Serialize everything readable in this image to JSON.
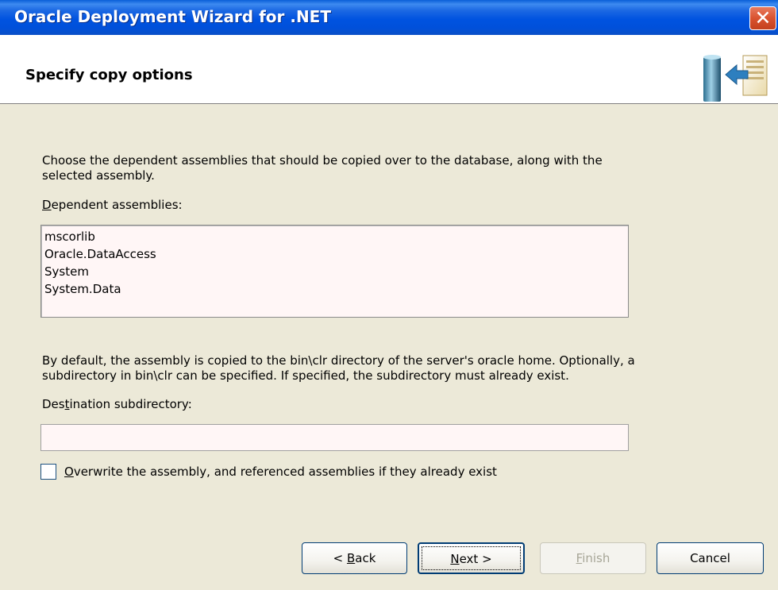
{
  "window": {
    "title": "Oracle Deployment Wizard for .NET",
    "close_glyph": "✕"
  },
  "header": {
    "title": "Specify copy options",
    "icon": "deploy-wizard-icon"
  },
  "main": {
    "intro_line1": "Choose the dependent assemblies that should be copied over to the database, along with the",
    "intro_line2": "selected assembly.",
    "dependent_label_hotkey": "D",
    "dependent_label_rest": "ependent assemblies:",
    "dependent_assemblies": [
      "mscorlib",
      "Oracle.DataAccess",
      "System",
      "System.Data"
    ],
    "default_line1": "By default, the assembly is copied to the bin\\clr directory of the server's oracle home.  Optionally, a",
    "default_line2": "subdirectory in bin\\clr can be specified.  If specified, the subdirectory must already exist.",
    "dest_label_pre": "Des",
    "dest_label_hotkey": "t",
    "dest_label_rest": "ination subdirectory:",
    "dest_value": "",
    "overwrite_hotkey": "O",
    "overwrite_rest": "verwrite the assembly, and referenced assemblies if they already exist",
    "overwrite_checked": false
  },
  "buttons": {
    "back_pre": "< ",
    "back_hotkey": "B",
    "back_rest": "ack",
    "next_hotkey": "N",
    "next_rest": "ext >",
    "finish_hotkey": "F",
    "finish_rest": "inish",
    "cancel": "Cancel"
  },
  "colors": {
    "titlebar": "#0053E0",
    "dialog_bg": "#ECE9D8",
    "field_bg": "#FFF6F6",
    "close_red": "#D9532F"
  }
}
